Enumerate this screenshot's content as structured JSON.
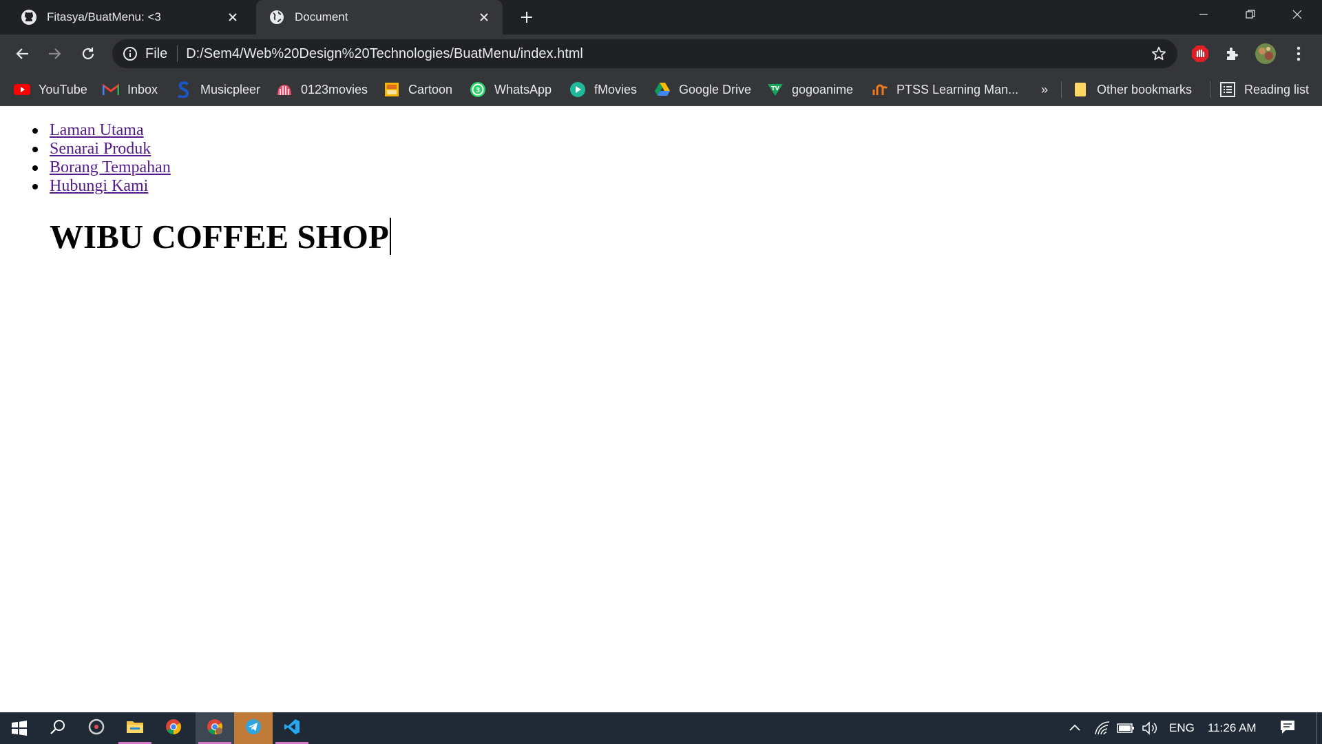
{
  "browser": {
    "tabs": [
      {
        "title": "Fitasya/BuatMenu: <3",
        "icon": "github-icon"
      },
      {
        "title": "Document",
        "icon": "globe-icon"
      }
    ],
    "omnibox": {
      "scheme_label": "File",
      "url": "D:/Sem4/Web%20Design%20Technologies/BuatMenu/index.html"
    },
    "bookmarks": [
      {
        "label": "YouTube",
        "icon": "youtube-icon"
      },
      {
        "label": "Inbox",
        "icon": "gmail-icon"
      },
      {
        "label": "Musicpleer",
        "icon": "musicpleer-icon"
      },
      {
        "label": "0123movies",
        "icon": "movies-icon"
      },
      {
        "label": "Cartoon",
        "icon": "cartoon-icon"
      },
      {
        "label": "WhatsApp",
        "icon": "whatsapp-icon"
      },
      {
        "label": "fMovies",
        "icon": "fmovies-icon"
      },
      {
        "label": "Google Drive",
        "icon": "google-drive-icon"
      },
      {
        "label": "gogoanime",
        "icon": "gogoanime-icon"
      },
      {
        "label": "PTSS Learning Man...",
        "icon": "ptss-icon"
      }
    ],
    "overflow_label": "»",
    "other_bookmarks_label": "Other bookmarks",
    "reading_list_label": "Reading list"
  },
  "page": {
    "menu": [
      {
        "label": "Laman Utama"
      },
      {
        "label": "Senarai Produk"
      },
      {
        "label": "Borang Tempahan"
      },
      {
        "label": "Hubungi Kami"
      }
    ],
    "heading": "WIBU COFFEE SHOP"
  },
  "taskbar": {
    "language": "ENG",
    "time": "11:26 AM"
  },
  "colors": {
    "tab_strip": "#202124",
    "toolbar": "#35363a",
    "visited_link": "#551a8b",
    "taskbar": "#1f2a36"
  }
}
